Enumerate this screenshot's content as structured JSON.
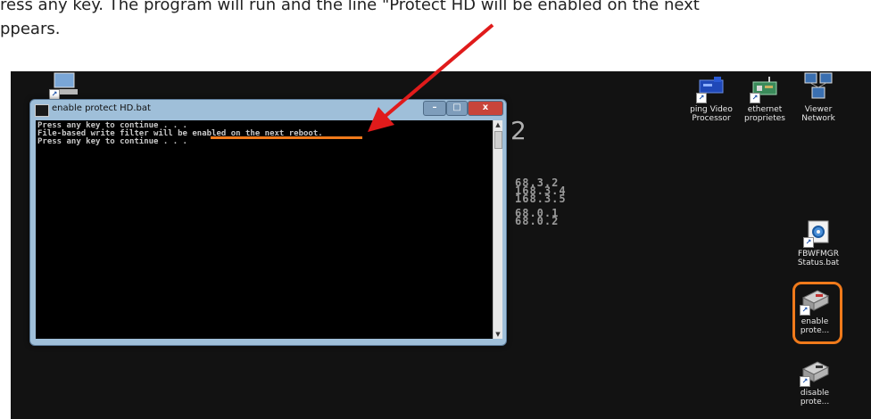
{
  "caption": {
    "line1": "ress any key. The program will run and the line \"Protect HD will be enabled on the next",
    "line2": "ppears."
  },
  "console_window": {
    "title": "enable protect HD.bat",
    "lines": [
      "Press any key to continue . . .",
      "File-based write filter will be enabled on the next reboot.",
      "Press any key to continue . . ."
    ],
    "buttons": {
      "minimize": "–",
      "maximize": "□",
      "close": "x"
    }
  },
  "desktop_bg_text": {
    "big": "2",
    "ips": [
      "68.3.2",
      "168.3.4",
      "168.3.5",
      "",
      "68.0.1",
      "68.0.2"
    ]
  },
  "desktop_icons": [
    {
      "name": "ping Video Processor",
      "line1": "ping Video",
      "line2": "Processor",
      "icon": "video-processor-icon"
    },
    {
      "name": "ethernet proprietes",
      "line1": "ethernet",
      "line2": "proprietes",
      "icon": "network-card-icon"
    },
    {
      "name": "Viewer Network",
      "line1": "Viewer",
      "line2": "Network",
      "icon": "network-icon"
    },
    {
      "name": "FBWFMGR Status.bat",
      "line1": "FBWFMGR",
      "line2": "Status.bat",
      "icon": "batch-gear-icon"
    },
    {
      "name": "enable prote...",
      "line1": "enable",
      "line2": "prote...",
      "icon": "hard-drive-icon"
    },
    {
      "name": "disable prote...",
      "line1": "disable",
      "line2": "prote...",
      "icon": "hard-drive-icon"
    }
  ],
  "colors": {
    "annotation_orange": "#f07a1b",
    "annotation_red": "#e01b1b",
    "console_bg": "#000000",
    "desktop_bg": "#121212"
  }
}
